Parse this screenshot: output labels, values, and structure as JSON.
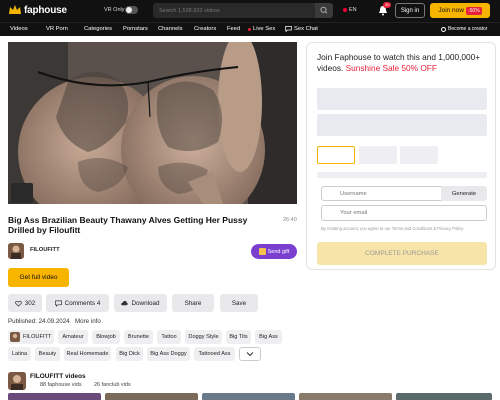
{
  "header": {
    "logo_text": "faphouse",
    "vr_only_label": "VR Only",
    "search_placeholder": "Search 1,528,933 videos",
    "language": "EN",
    "notifications_count": "30",
    "signin_label": "Sign in",
    "join_label": "Join now",
    "join_discount": "-50%"
  },
  "nav": {
    "items": [
      "Videos",
      "VR Porn",
      "Categories",
      "Pornstars",
      "Channels",
      "Creators",
      "Feed",
      "Live Sex",
      "Sex Chat"
    ],
    "become_creator": "Become a creator"
  },
  "video": {
    "title": "Big Ass Brazilian Beauty Thawany Alves Getting Her Pussy Drilled by Filoufitt",
    "duration": "26:40",
    "channel": "FILOUFITT",
    "send_gift": "Send gift",
    "get_full": "Get full video",
    "actions": {
      "likes": "302",
      "comments": "Comments 4",
      "download": "Download",
      "share": "Share",
      "save": "Save"
    },
    "published": "Published: 24.09.2024",
    "more_info": "More info",
    "tags_row1": [
      "FILOUFITT",
      "Amateur",
      "Blowjob",
      "Brunette",
      "Tattoo",
      "Doggy Style",
      "Big Tits",
      "Big Ass"
    ],
    "tags_row2": [
      "Latina",
      "Beauty",
      "Real Homemade",
      "Big Dick",
      "Big Ass Doggy",
      "Tattooed Ass"
    ]
  },
  "channel_section": {
    "heading": "FILOUFITT videos",
    "faphouse_vids": "88 faphouse vids",
    "fanclub_vids": "26 fanclub vids"
  },
  "promo": {
    "title_main": "Join Faphouse to watch this and 1,000,000+ videos. ",
    "title_sale": "Sunshine Sale 50% OFF",
    "username_placeholder": "Username",
    "generate_label": "Generate",
    "email_placeholder": "Your email",
    "terms_text": "By creating account, you agree to our Terms and Conditions & Privacy Policy",
    "complete_label": "COMPLETE PURCHASE"
  },
  "colors": {
    "accent_yellow": "#f7b500",
    "sale_red": "#e8223b",
    "gift_purple": "#7b3fd0",
    "header_bg": "#111111"
  }
}
